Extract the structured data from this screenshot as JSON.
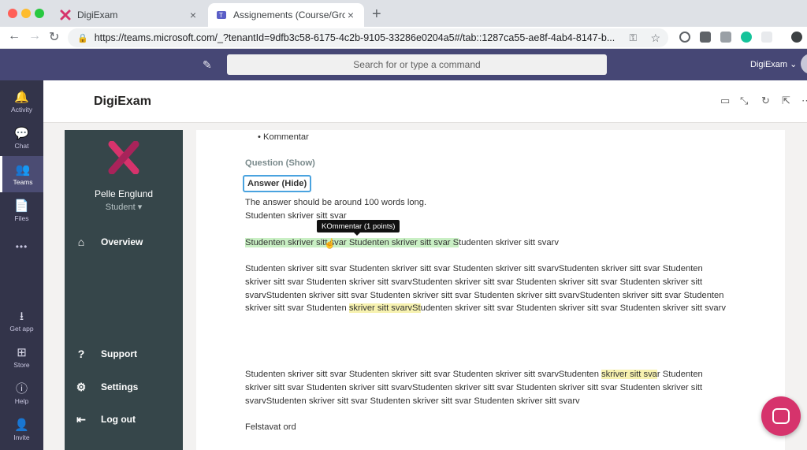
{
  "browser": {
    "tabs": [
      {
        "title": "DigiExam",
        "active": false
      },
      {
        "title": "Assignements (Course/Group C",
        "active": true
      }
    ],
    "new_tab_label": "+",
    "url": "https://teams.microsoft.com/_?tenantId=9dfb3c58-6175-4c2b-9105-33286e0204a5#/tab::1287ca55-ae8f-4ab4-8147-b..."
  },
  "teams": {
    "search_placeholder": "Search for or type a command",
    "user_menu": "DigiExam ⌄",
    "appbar": [
      {
        "label": "Activity",
        "icon": "bell-icon",
        "glyph": "🔔"
      },
      {
        "label": "Chat",
        "icon": "chat-icon",
        "glyph": "💬"
      },
      {
        "label": "Teams",
        "icon": "teams-icon",
        "glyph": "👥"
      },
      {
        "label": "Files",
        "icon": "file-icon",
        "glyph": "📄"
      },
      {
        "label": "•••",
        "icon": "more-icon",
        "glyph": ""
      },
      {
        "label": "Get app",
        "icon": "download-icon",
        "glyph": "⭳"
      },
      {
        "label": "Store",
        "icon": "store-icon",
        "glyph": "⊞"
      },
      {
        "label": "Help",
        "icon": "help-icon",
        "glyph": "?"
      },
      {
        "label": "Invite",
        "icon": "invite-icon",
        "glyph": "👤"
      }
    ],
    "app_title": "DigiExam"
  },
  "sidebar": {
    "user_name": "Pelle Englund",
    "role": "Student ▾",
    "nav": {
      "overview": "Overview",
      "support": "Support",
      "settings": "Settings",
      "logout": "Log out"
    }
  },
  "content": {
    "bullet": "Kommentar",
    "question_toggle": "Question (Show)",
    "answer_toggle": "Answer (Hide)",
    "instruction": "The answer should be around 100 words long.",
    "line1": "Studenten skriver sitt svar",
    "tooltip": "KOmmentar (1 points)",
    "highlight_line": {
      "green": "Studenten skriver sitt svar Studenten skriver sitt svar S",
      "rest": "tudenten skriver sitt svarv"
    },
    "para1": {
      "before": "Studenten skriver sitt svar Studenten skriver sitt svar Studenten skriver sitt svarvStudenten skriver sitt svar Studenten skriver sitt svar Studenten skriver sitt svarvStudenten skriver sitt svar Studenten skriver sitt svar Studenten skriver sitt svarvStudenten skriver sitt svar Studenten skriver sitt svar Studenten skriver sitt svarvStudenten skriver sitt svar Studenten skriver sitt svar Studenten ",
      "highlight": "skriver sitt svarvSt",
      "after": "udenten skriver sitt svar Studenten skriver sitt svar Studenten skriver sitt svarv"
    },
    "para2": {
      "before": "Studenten skriver sitt svar Studenten skriver sitt svar Studenten skriver sitt svarvStudenten ",
      "highlight": "skriver sitt sva",
      "after": "r Studenten skriver sitt svar Studenten skriver sitt svarvStudenten skriver sitt svar Studenten skriver sitt svar Studenten skriver sitt svarvStudenten skriver sitt svar Studenten skriver sitt svar Studenten skriver sitt svarv"
    },
    "footer_text": "Felstavat ord"
  },
  "colors": {
    "teams_purple": "#464775",
    "appbar": "#33344a",
    "sidebar": "#36464a",
    "accent_pink": "#d6336c",
    "highlight_green": "#c9efc4",
    "highlight_yellow": "#f7f2b0"
  }
}
